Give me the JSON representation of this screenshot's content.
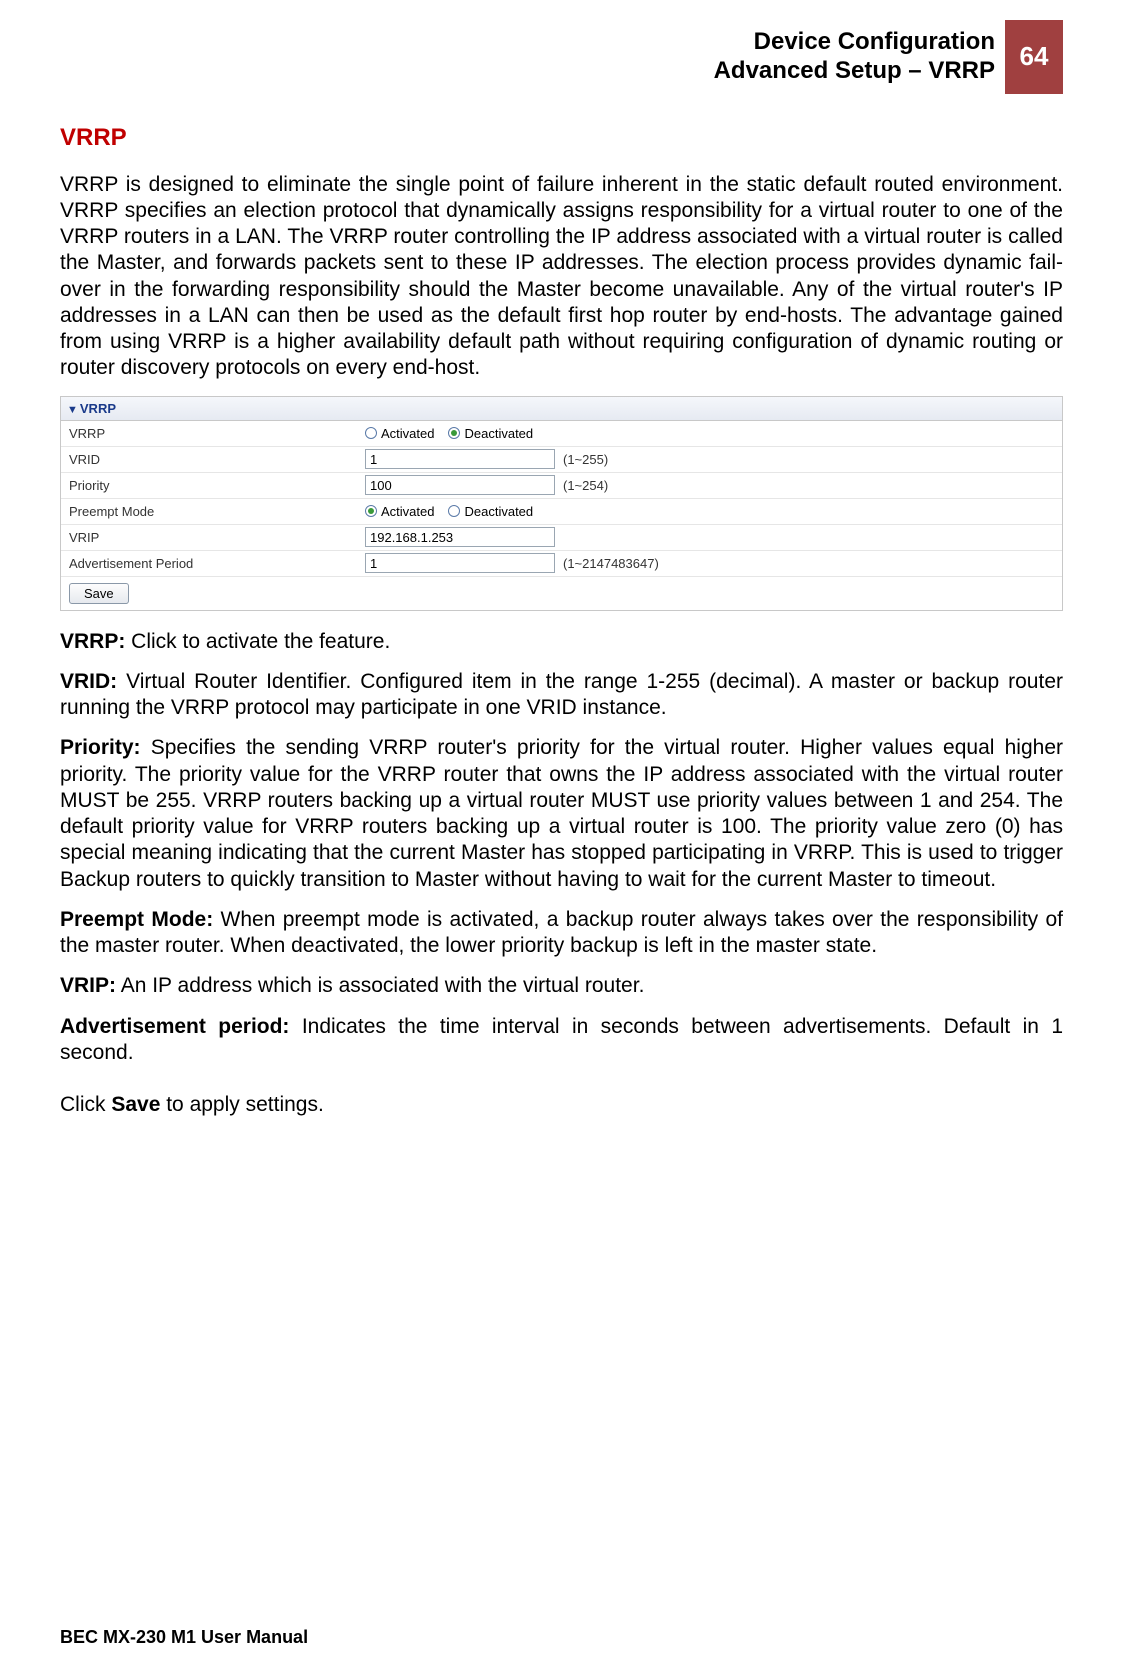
{
  "header": {
    "line1": "Device Configuration",
    "line2": "Advanced Setup – VRRP",
    "page_number": "64"
  },
  "section_title": "VRRP",
  "intro": "VRRP is designed to eliminate the single point of failure inherent in the static default routed environment. VRRP specifies an election protocol that dynamically assigns responsibility for a virtual router to one of the VRRP routers in a LAN. The VRRP router controlling the IP address associated with a virtual router is called the Master, and forwards packets sent to these IP addresses. The election process provides dynamic fail-over in the forwarding responsibility should the Master become unavailable. Any of the virtual router's IP addresses in a LAN can then be used as the default first hop router by end-hosts. The advantage gained from using VRRP is a higher availability default path without requiring configuration of dynamic routing or router discovery protocols on every end-host.",
  "panel": {
    "title": "VRRP",
    "rows": {
      "vrrp": {
        "label": "VRRP",
        "option_activated": "Activated",
        "option_deactivated": "Deactivated",
        "selected": "deactivated"
      },
      "vrid": {
        "label": "VRID",
        "value": "1",
        "suffix": "(1~255)"
      },
      "priority": {
        "label": "Priority",
        "value": "100",
        "suffix": "(1~254)"
      },
      "preempt": {
        "label": "Preempt Mode",
        "option_activated": "Activated",
        "option_deactivated": "Deactivated",
        "selected": "activated"
      },
      "vrip": {
        "label": "VRIP",
        "value": "192.168.1.253"
      },
      "advperiod": {
        "label": "Advertisement Period",
        "value": "1",
        "suffix": "(1~2147483647)"
      }
    },
    "save_button": "Save"
  },
  "descriptions": {
    "vrrp_label": "VRRP:",
    "vrrp_text": " Click to activate the feature.",
    "vrid_label": "VRID:",
    "vrid_text": " Virtual Router Identifier. Configured item in the range 1-255 (decimal). A master or backup router running the VRRP protocol may participate in one VRID instance.",
    "priority_label": "Priority:",
    "priority_text": " Specifies the sending VRRP router's priority for the virtual router. Higher values equal higher priority. The priority value for the VRRP router that owns the IP address associated with the virtual router MUST be 255. VRRP routers backing up a virtual router MUST use priority values between 1 and 254. The default priority value for VRRP routers backing up a virtual router is 100. The priority value zero (0) has special meaning indicating that the current Master has stopped participating in VRRP. This is used to trigger Backup routers to quickly transition to Master without having to wait for the current Master to timeout.",
    "preempt_label": "Preempt Mode:",
    "preempt_text": " When preempt mode is activated, a backup router always takes over the responsibility of the master router. When deactivated, the lower priority backup is left in the master state.",
    "vrip_label": "VRIP:",
    "vrip_text": " An IP address which is associated with the virtual router.",
    "advperiod_label": "Advertisement period:",
    "advperiod_text": " Indicates the time interval in seconds between advertisements. Default in 1 second.",
    "click_prefix": "Click ",
    "click_bold": "Save",
    "click_suffix": " to apply settings."
  },
  "footer": "BEC MX-230 M1 User Manual"
}
